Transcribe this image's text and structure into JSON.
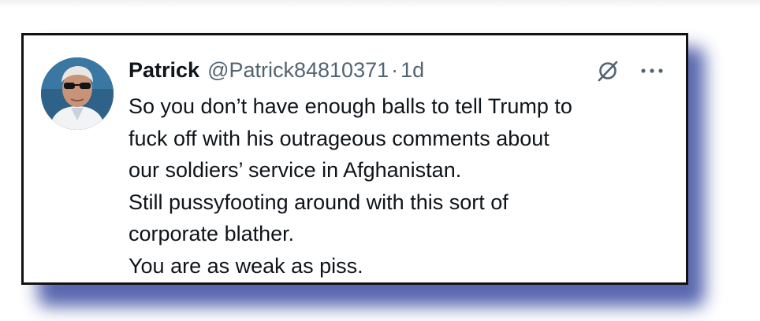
{
  "tweet": {
    "display_name": "Patrick",
    "handle": "@Patrick84810371",
    "separator": "·",
    "age": "1d",
    "lines": [
      "So you don’t have enough balls to tell Trump to",
      "fuck off with his outrageous comments about",
      "our soldiers’ service in Afghanistan.",
      "Still pussyfooting around with this sort of",
      "corporate blather.",
      "You are as weak as piss."
    ]
  },
  "icons": {
    "avatar": "profile-photo",
    "grok": "grok-icon",
    "more": "more-options-icon"
  },
  "colors": {
    "card_border": "#111111",
    "shadow": "#4a5aa8",
    "primary_text": "#0f1419",
    "secondary_text": "#536471"
  }
}
